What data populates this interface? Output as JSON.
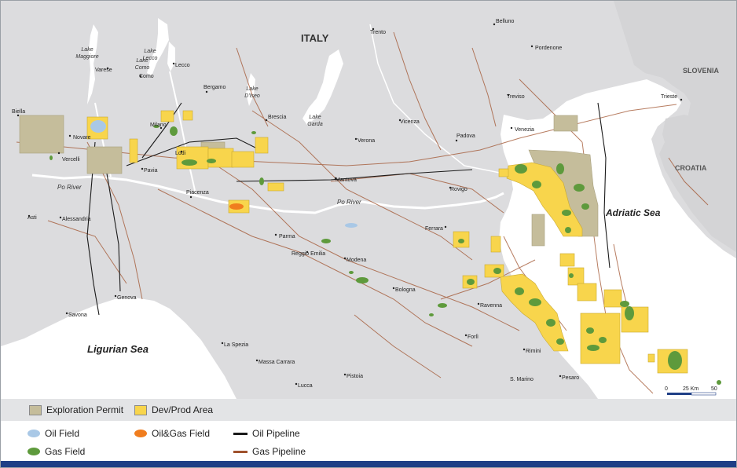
{
  "map": {
    "country_label": "ITALY",
    "neighbor_labels": [
      "SLOVENIA",
      "CROATIA"
    ],
    "water_labels": {
      "adriatic": "Adriatic Sea",
      "ligurian": "Ligurian Sea",
      "po_river_west": "Po River",
      "po_river_east": "Po River",
      "lake_maggiore_1": "Lake",
      "lake_maggiore_2": "Maggiore",
      "lake_lecco_1": "Lake",
      "lake_lecco_2": "Lecco",
      "lake_como_1": "Lake",
      "lake_como_2": "Como",
      "lake_iseo_1": "Lake",
      "lake_iseo_2": "D'Iseo",
      "lake_garda_1": "Lake",
      "lake_garda_2": "Garda"
    },
    "cities": {
      "biella": "Biella",
      "novare": "Novare",
      "vercelli": "Vercelli",
      "varese": "Varese",
      "como": "Como",
      "lecco": "Lecco",
      "bergamo": "Bergamo",
      "milano": "Milano",
      "lodi": "Lodi",
      "pavia": "Pavia",
      "brescia": "Brescia",
      "trento": "Trento",
      "belluno": "Belluno",
      "pordenone": "Pordenone",
      "treviso": "Treviso",
      "venezia": "Venezia",
      "padova": "Padova",
      "vicenza": "Vicenza",
      "verona": "Verona",
      "trieste": "Trieste",
      "mantova": "Mantova",
      "rovigo": "Rovigo",
      "piacenza": "Piacenza",
      "asti": "Asti",
      "alessandria": "Alessandria",
      "ferrara": "Ferrara",
      "parma": "Parma",
      "reggio_emilia": "Reggio Emilia",
      "modena": "Modena",
      "bologna": "Bologna",
      "genova": "Genova",
      "savona": "Savona",
      "ravenna": "Ravenna",
      "forli": "Forlì",
      "rimini": "Rimini",
      "s_marino": "S. Marino",
      "pesaro": "Pesaro",
      "la_spezia": "La Spezia",
      "massa_carrara": "Massa Carrara",
      "pistoia": "Pistoia",
      "lucca": "Lucca"
    },
    "scale": {
      "zero": "0",
      "mid": "25 Km",
      "end": "50"
    }
  },
  "legend": {
    "exploration_permit": "Exploration Permit",
    "dev_prod_area": "Dev/Prod Area",
    "oil_field": "Oil Field",
    "oil_gas_field": "Oil&Gas Field",
    "oil_pipeline": "Oil Pipeline",
    "gas_field": "Gas Field",
    "gas_pipeline": "Gas Pipeline"
  },
  "colors": {
    "land": "#dcdcde",
    "sea": "#ffffff",
    "exploration": "#c5bd9b",
    "dev_prod": "#f8d54c",
    "oil_field": "#a9c8e6",
    "oil_gas_field": "#f07d1e",
    "gas_field": "#5e9a3c",
    "oil_pipeline": "#1a1a1a",
    "gas_pipeline": "#a0522d",
    "brand_bar": "#1f3f86"
  }
}
